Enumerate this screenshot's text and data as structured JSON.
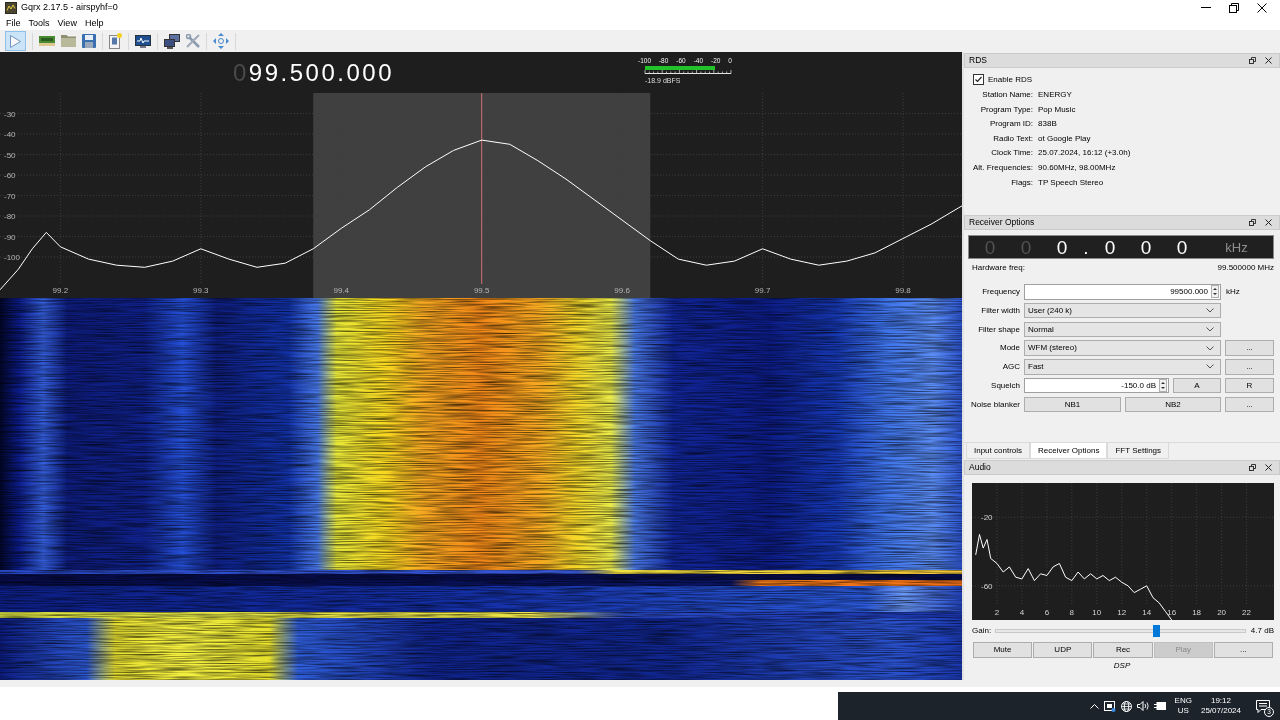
{
  "window": {
    "title": "Gqrx 2.17.5 - airspyhf=0"
  },
  "menu": [
    "File",
    "Tools",
    "View",
    "Help"
  ],
  "toolbar": {
    "start_checked": true
  },
  "frequency_display": {
    "digits": [
      {
        "text": "0",
        "dim": true
      },
      {
        "text": "99.500.000",
        "dim": false
      }
    ]
  },
  "meter": {
    "scale": [
      "-100",
      "-80",
      "-60",
      "-40",
      "-20",
      "0"
    ],
    "level": 0.81,
    "reading": "-18.9 dBFS"
  },
  "spectrum": {
    "chart_data": [
      {
        "type": "line",
        "x": [
          99.157,
          99.17,
          99.18,
          99.19,
          99.2,
          99.22,
          99.24,
          99.26,
          99.28,
          99.3,
          99.32,
          99.34,
          99.36,
          99.38,
          99.4,
          99.42,
          99.44,
          99.46,
          99.48,
          99.5,
          99.52,
          99.54,
          99.56,
          99.58,
          99.6,
          99.62,
          99.64,
          99.66,
          99.68,
          99.7,
          99.72,
          99.74,
          99.76,
          99.78,
          99.8,
          99.82,
          99.842
        ],
        "values": [
          -116,
          -106,
          -96,
          -88,
          -95,
          -101,
          -104,
          -105,
          -102,
          -96,
          -101,
          -105,
          -103,
          -96,
          -86,
          -77,
          -66,
          -56,
          -48,
          -43,
          -45,
          -53,
          -62,
          -72,
          -82,
          -92,
          -101,
          -104,
          -102,
          -96,
          -101,
          -104,
          -102,
          -98,
          -91,
          -84,
          -75
        ],
        "color": "#ffffff",
        "xlim": [
          99.157,
          99.842
        ],
        "ylim": [
          -120,
          -20
        ],
        "xticks": [
          99.2,
          99.3,
          99.4,
          99.5,
          99.6,
          99.7,
          99.8
        ],
        "yticks": [
          -100,
          -90,
          -80,
          -70,
          -60,
          -50,
          -40,
          -30
        ],
        "grid": true,
        "bands": [
          {
            "axis": "x",
            "from": 99.38,
            "to": 99.62,
            "color": "#404040"
          }
        ],
        "ref_lines": [
          {
            "axis": "x",
            "value": 99.5,
            "color": "#d07070"
          }
        ]
      }
    ]
  },
  "rds": {
    "title": "RDS",
    "enable": {
      "label": "Enable RDS",
      "checked": true
    },
    "fields": [
      {
        "label": "Station Name:",
        "value": "ENERGY"
      },
      {
        "label": "Program Type:",
        "value": "Pop Music"
      },
      {
        "label": "Program ID:",
        "value": "838B"
      },
      {
        "label": "Radio Text:",
        "value": "ot Google Play"
      },
      {
        "label": "Clock Time:",
        "value": "25.07.2024, 16:12 (+3.0h)"
      },
      {
        "label": "Alt. Frequencies:",
        "value": "90.60MHz, 98.00MHz"
      },
      {
        "label": "Flags:",
        "value": "TP Speech Stereo"
      }
    ]
  },
  "receiver_options": {
    "title": "Receiver Options",
    "display": {
      "digits": [
        {
          "kind": "digit",
          "text": "0",
          "dim": true
        },
        {
          "kind": "digit",
          "text": "0",
          "dim": true
        },
        {
          "kind": "digit",
          "text": "0",
          "dim": false
        },
        {
          "kind": "separator",
          "text": ".",
          "dim": false
        },
        {
          "kind": "digit",
          "text": "0",
          "dim": false
        },
        {
          "kind": "digit",
          "text": "0",
          "dim": false
        },
        {
          "kind": "digit",
          "text": "0",
          "dim": false
        }
      ],
      "unit": "kHz"
    },
    "hardware_freq": {
      "label": "Hardware freq:",
      "value": "99.500000 MHz"
    },
    "rows": [
      {
        "label": "Frequency",
        "controls": [
          {
            "kind": "spinbox",
            "value": "99500.000"
          },
          {
            "kind": "unit",
            "text": "kHz"
          }
        ]
      },
      {
        "label": "Filter width",
        "controls": [
          {
            "kind": "select",
            "value": "User (240 k)"
          }
        ]
      },
      {
        "label": "Filter shape",
        "controls": [
          {
            "kind": "select",
            "value": "Normal"
          }
        ]
      },
      {
        "label": "Mode",
        "controls": [
          {
            "kind": "select",
            "value": "WFM (stereo)"
          },
          {
            "kind": "button",
            "text": "..."
          }
        ]
      },
      {
        "label": "AGC",
        "controls": [
          {
            "kind": "select",
            "value": "Fast"
          },
          {
            "kind": "button",
            "text": "..."
          }
        ]
      },
      {
        "label": "Squelch",
        "controls": [
          {
            "kind": "spinbox",
            "value": "-150.0 dB"
          },
          {
            "kind": "button",
            "text": "A"
          },
          {
            "kind": "button",
            "text": "R"
          }
        ]
      },
      {
        "label": "Noise blanker",
        "controls": [
          {
            "kind": "button",
            "text": "NB1"
          },
          {
            "kind": "button",
            "text": "NB2"
          },
          {
            "kind": "button",
            "text": "..."
          }
        ]
      }
    ]
  },
  "dock_tabs": [
    {
      "label": "Input controls",
      "selected": false
    },
    {
      "label": "Receiver Options",
      "selected": true
    },
    {
      "label": "FFT Settings",
      "selected": false
    }
  ],
  "audio": {
    "title": "Audio",
    "chart_data": [
      {
        "type": "line",
        "x": [
          0.3,
          0.6,
          0.9,
          1.2,
          1.5,
          2,
          2.5,
          3,
          3.5,
          4,
          4.5,
          5,
          5.5,
          6,
          6.5,
          7,
          7.5,
          8,
          8.5,
          9,
          9.5,
          10,
          10.5,
          11,
          11.5,
          12,
          12.5,
          13,
          13.5,
          14,
          14.5,
          15,
          15.5,
          16
        ],
        "values": [
          -42,
          -30,
          -38,
          -33,
          -44,
          -47,
          -52,
          -49,
          -55,
          -56,
          -50,
          -57,
          -53,
          -54,
          -49,
          -47,
          -55,
          -57,
          -52,
          -56,
          -53,
          -56,
          -54,
          -57,
          -55,
          -58,
          -60,
          -64,
          -62,
          -60,
          -67,
          -70,
          -75,
          -80
        ],
        "color": "#ffffff",
        "xlim": [
          0,
          24.2
        ],
        "ylim": [
          -80,
          0
        ],
        "xticks": [
          2,
          4,
          6,
          8,
          10,
          12,
          14,
          16,
          18,
          20,
          22
        ],
        "yticks": [
          -20,
          -60
        ],
        "grid": true
      }
    ],
    "gain": {
      "label": "Gain:",
      "level": 0.644,
      "reading": "4.7 dB"
    },
    "buttons": [
      {
        "label": "Mute",
        "disabled": false
      },
      {
        "label": "UDP",
        "disabled": false
      },
      {
        "label": "Rec",
        "disabled": false
      },
      {
        "label": "Play",
        "disabled": true
      },
      {
        "label": "...",
        "disabled": false
      }
    ],
    "footer": "DSP"
  },
  "taskbar": {
    "language": "ENG",
    "region": "US",
    "time": "19:12",
    "date": "25/07/2024",
    "notifications": "3"
  }
}
